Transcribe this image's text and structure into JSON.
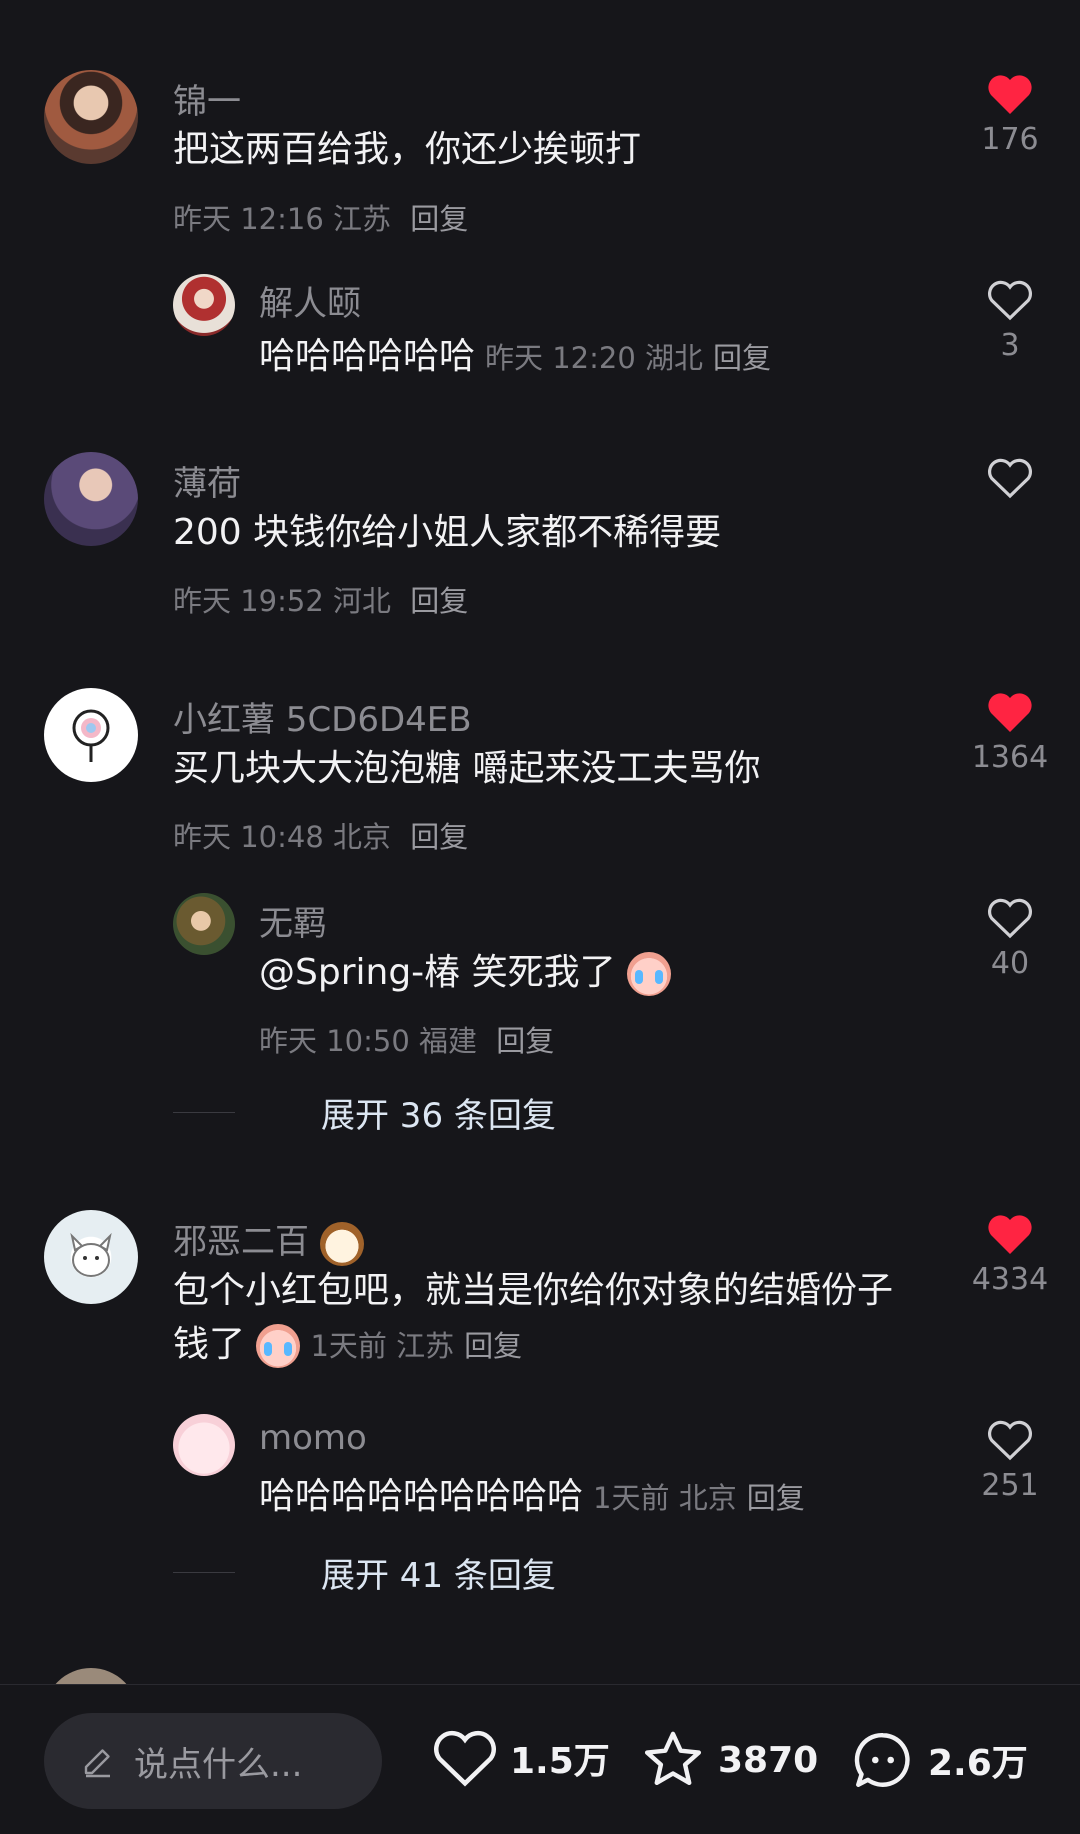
{
  "comments": [
    {
      "username": "锦一",
      "text": "把这两百给我，你还少挨顿打",
      "time": "昨天 12:16",
      "location": "江苏",
      "reply_label": "回复",
      "likes": "176",
      "liked": true,
      "replies": [
        {
          "username": "解人颐",
          "text": "哈哈哈哈哈哈",
          "time": "昨天 12:20",
          "location": "湖北",
          "reply_label": "回复",
          "likes": "3",
          "liked": false
        }
      ]
    },
    {
      "username": "薄荷",
      "text": "200 块钱你给小姐人家都不稀得要",
      "time": "昨天 19:52",
      "location": "河北",
      "reply_label": "回复",
      "likes": "",
      "liked": false
    },
    {
      "username": "小红薯 5CD6D4EB",
      "text": "买几块大大泡泡糖 嚼起来没工夫骂你",
      "time": "昨天 10:48",
      "location": "北京",
      "reply_label": "回复",
      "likes": "1364",
      "liked": true,
      "replies": [
        {
          "username": "无羁",
          "text": "@Spring-椿 笑死我了",
          "time": "昨天 10:50",
          "location": "福建",
          "reply_label": "回复",
          "likes": "40",
          "liked": false
        }
      ],
      "expand_label": "展开 36 条回复"
    },
    {
      "username": "邪恶二百",
      "text_line1": "包个小红包吧，就当是你给你对象的结婚份子",
      "text_line2": "钱了",
      "time": "1天前",
      "location": "江苏",
      "reply_label": "回复",
      "likes": "4334",
      "liked": true,
      "replies": [
        {
          "username": "momo",
          "text": "哈哈哈哈哈哈哈哈哈",
          "time": "1天前",
          "location": "北京",
          "reply_label": "回复",
          "likes": "251",
          "liked": false
        }
      ],
      "expand_label": "展开 41 条回复"
    }
  ],
  "bottom_bar": {
    "input_placeholder": "说点什么...",
    "likes_count": "1.5万",
    "favorites_count": "3870",
    "comments_count": "2.6万"
  },
  "icons": {
    "heart_filled": "heart-filled-icon",
    "heart_outline": "heart-outline-icon",
    "star": "star-icon",
    "comment": "comment-bubble-icon",
    "pencil": "pencil-icon"
  },
  "colors": {
    "background": "#16161a",
    "liked_red": "#ff2442",
    "text_primary": "#f2f2f4",
    "text_secondary": "#8c8c92",
    "expand_link": "#dce6f2"
  }
}
